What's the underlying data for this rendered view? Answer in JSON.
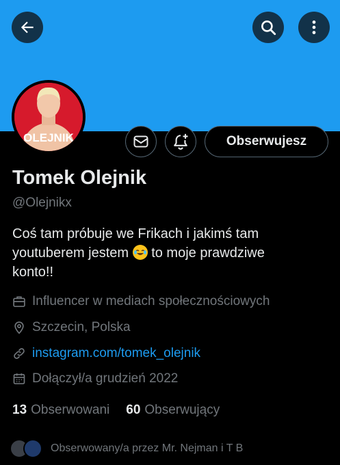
{
  "profile": {
    "name": "Tomek Olejnik",
    "handle": "@Olejnikx",
    "bio_line1": "Coś tam próbuje we Frikach i jakimś tam",
    "bio_line2a": "youtuberem jestem ",
    "bio_line2b": " to moje prawdziwe",
    "bio_line3": "konto!!",
    "avatar_text": "OLEJNIK",
    "category": "Influencer w mediach społecznościowych",
    "location": "Szczecin, Polska",
    "link": "instagram.com/tomek_olejnik",
    "joined": "Dołączył/a grudzień 2022"
  },
  "actions": {
    "follow_label": "Obserwujesz"
  },
  "stats": {
    "following_count": "13",
    "following_label": "Obserwowani",
    "followers_count": "60",
    "followers_label": "Obserwujący"
  },
  "followed_by": "Obserwowany/a przez Mr. Nejman i T B",
  "icons": {
    "back": "arrow-left-icon",
    "search": "search-icon",
    "more": "more-vertical-icon",
    "message": "envelope-icon",
    "notify": "bell-plus-icon",
    "category": "briefcase-icon",
    "location": "location-pin-icon",
    "link": "link-icon",
    "joined": "calendar-icon",
    "emoji": "face-with-tears-of-joy-icon"
  },
  "colors": {
    "banner": "#1d9bf0",
    "background": "#000000",
    "link": "#1d9bf0",
    "muted": "#71767b",
    "text": "#e7e9ea"
  }
}
